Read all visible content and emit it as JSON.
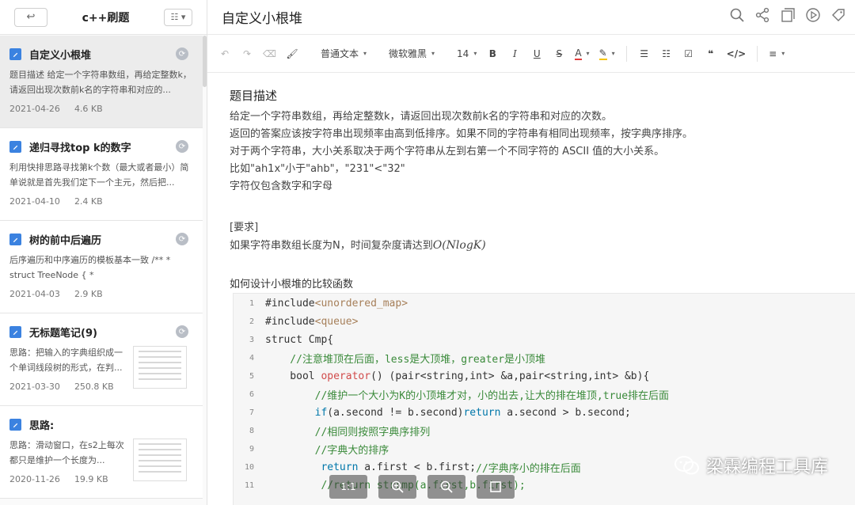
{
  "sidebar": {
    "folder_title": "c++刷题",
    "back_label": "↩",
    "view_label": "☷ ▾",
    "notes": [
      {
        "title": "自定义小根堆",
        "snippet": "题目描述 给定一个字符串数组，再给定整数k，请返回出现次数前k名的字符串和对应的...",
        "date": "2021-04-26",
        "size": "4.6 KB"
      },
      {
        "title": "递归寻找top k的数字",
        "snippet": "利用快排思路寻找第k个数（最大或者最小）简单说就是首先我们定下一个主元，然后把...",
        "date": "2021-04-10",
        "size": "2.4 KB"
      },
      {
        "title": "树的前中后遍历",
        "snippet": "后序遍历和中序遍历的模板基本一致 /** * struct TreeNode { *",
        "date": "2021-04-03",
        "size": "2.9 KB"
      },
      {
        "title": "无标题笔记(9)",
        "snippet": "思路：把输入的字典组织成一个单词线段树的形式，在判...",
        "date": "2021-03-30",
        "size": "250.8 KB"
      },
      {
        "title": "思路:",
        "snippet": "思路：滑动窗口，在s2上每次都只是维护一个长度为...",
        "date": "2020-11-26",
        "size": "19.9 KB"
      }
    ]
  },
  "doc": {
    "title": "自定义小根堆"
  },
  "toolbar": {
    "para_style": "普通文本",
    "font": "微软雅黑",
    "font_size": "14",
    "bold": "B",
    "italic": "I",
    "underline": "U",
    "strike": "S",
    "color": "A",
    "quote": "❝",
    "code": "</>"
  },
  "content": {
    "heading": "题目描述",
    "lines": [
      "给定一个字符串数组，再给定整数k，请返回出现次数前k名的字符串和对应的次数。",
      "返回的答案应该按字符串出现频率由高到低排序。如果不同的字符串有相同出现频率，按字典序排序。",
      "对于两个字符串，大小关系取决于两个字符串从左到右第一个不同字符的 ASCII 值的大小关系。",
      "比如\"ah1x\"小于\"ahb\"，\"231\"<\"32\"",
      "字符仅包含数字和字母"
    ],
    "req_label": "[要求]",
    "req_text": "如果字符串数组长度为N，时间复杂度请达到",
    "req_math": "O(NlogK)",
    "cmp_heading": "如何设计小根堆的比较函数"
  },
  "code": {
    "line_numbers": [
      "1",
      "2",
      "3",
      "4",
      "5",
      "6",
      "7",
      "8",
      "9",
      "10",
      "11"
    ],
    "l1a": "#include",
    "l1b": "<unordered_map>",
    "l2a": "#include",
    "l2b": "<queue>",
    "l3": "struct Cmp{",
    "l4": "    //注意堆顶在后面，less是大顶堆，greater是小顶堆",
    "l5a": "    bool ",
    "l5b": "operator",
    "l5c": "() (pair<string,int> &a,pair<string,int> &b){",
    "l6": "        //维护一个大小为K的小顶堆才对，小的出去,让大的排在堆顶,true排在后面",
    "l7a": "        if",
    "l7b": "(a.second != b.second)",
    "l7c": "return",
    "l7d": " a.second > b.second;",
    "l8": "        //相同则按照字典序排列",
    "l9": "        //字典大的排序",
    "l10a": "         return",
    "l10b": " a.first < b.first;",
    "l10c": "//字典序小的排在后面",
    "l11": "         //return strcmp(a.first,b.first);"
  },
  "image_viewer": {
    "btn1": "1:1"
  },
  "watermark": "梁霖编程工具库"
}
